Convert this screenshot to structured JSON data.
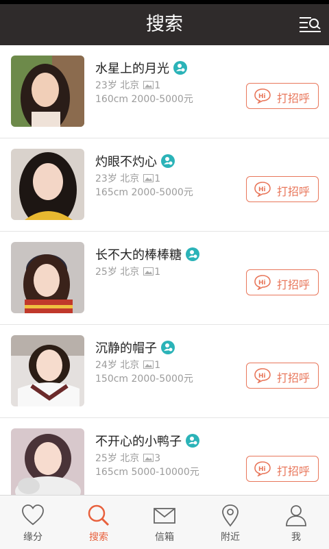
{
  "header": {
    "title": "搜索"
  },
  "profiles": [
    {
      "name": "水星上的月光",
      "age": "23岁",
      "city": "北京",
      "photos": "1",
      "extra": "160cm 2000-5000元",
      "greet_label": "打招呼"
    },
    {
      "name": "灼眼不灼心",
      "age": "23岁",
      "city": "北京",
      "photos": "1",
      "extra": "165cm 2000-5000元",
      "greet_label": "打招呼"
    },
    {
      "name": "长不大的棒棒糖",
      "age": "25岁",
      "city": "北京",
      "photos": "1",
      "extra": "",
      "greet_label": "打招呼"
    },
    {
      "name": "沉静的帽子",
      "age": "24岁",
      "city": "北京",
      "photos": "1",
      "extra": "150cm 2000-5000元",
      "greet_label": "打招呼"
    },
    {
      "name": "不开心的小鸭子",
      "age": "25岁",
      "city": "北京",
      "photos": "3",
      "extra": "165cm 5000-10000元",
      "greet_label": "打招呼"
    }
  ],
  "tabs": [
    {
      "label": "缘分",
      "icon": "heart-icon"
    },
    {
      "label": "搜索",
      "icon": "search-icon",
      "active": true
    },
    {
      "label": "信箱",
      "icon": "mail-icon"
    },
    {
      "label": "附近",
      "icon": "location-pin-icon"
    },
    {
      "label": "我",
      "icon": "user-icon"
    }
  ],
  "colors": {
    "accent": "#e8603c",
    "verify": "#2bb3b8",
    "header_bg": "#2f2b2b"
  }
}
